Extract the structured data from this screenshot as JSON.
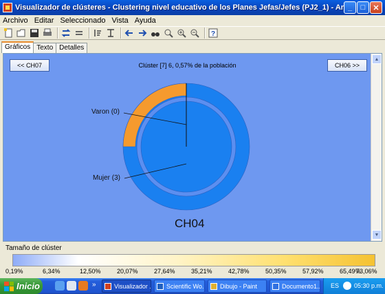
{
  "window": {
    "title": "Visualizador de clústeres - Clustering nivel educativo de los Planes Jefas/Jefes (PJ2_1) - Archivo local: general I...",
    "minimize": "_",
    "maximize": "□",
    "close": "✕"
  },
  "menu": [
    "Archivo",
    "Editar",
    "Seleccionado",
    "Vista",
    "Ayuda"
  ],
  "tabs": [
    "Gráficos",
    "Texto",
    "Detalles"
  ],
  "chart_view": {
    "prev_button": "<< CH07",
    "next_button": "CH06 >>",
    "cluster_info": "Clúster [7] 6, 0,57% de la población",
    "cluster_label": "CH04"
  },
  "chart_data": {
    "type": "pie",
    "title": "Clúster [7] 6, 0,57% de la población",
    "center_label": "CH04",
    "rings": [
      {
        "categories": [
          "Varon (0)",
          "Mujer (3)"
        ],
        "values": [
          0,
          3
        ]
      }
    ],
    "outer_ring_highlight_fraction": 0.25,
    "colors": {
      "base": "#1a80f0",
      "highlight": "#f59a2e",
      "inner_ring": "#5c8ff0"
    }
  },
  "legend": {
    "title": "Tamaño de clúster",
    "ticks": [
      "0,19%",
      "6,34%",
      "12,50%",
      "20,07%",
      "27,64%",
      "35,21%",
      "42,78%",
      "50,35%",
      "57,92%",
      "65,49%",
      "73,06%"
    ]
  },
  "taskbar": {
    "start": "Inicio",
    "more": "»",
    "tasks": [
      "Visualizador ...",
      "Scientific Wo...",
      "Dibujo - Paint",
      "Documento1...."
    ],
    "lang": "ES",
    "clock": "05:30 p.m."
  }
}
